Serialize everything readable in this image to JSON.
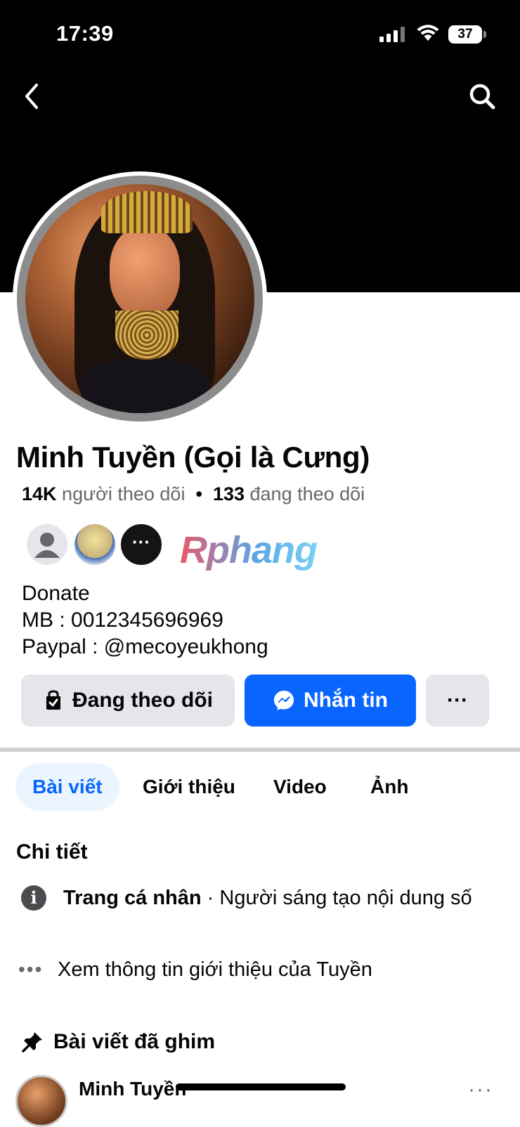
{
  "status_bar": {
    "time": "17:39",
    "battery": "37"
  },
  "profile": {
    "name": "Minh Tuyền (Gọi là Cưng)",
    "followers_count": "14K",
    "followers_label": "người theo dõi",
    "separator": "•",
    "following_count": "133",
    "following_label": "đang theo dõi",
    "friends_more": "···",
    "watermark": "Rphang",
    "bio": [
      "Donate",
      "MB : 0012345696969",
      "Paypal : @mecoyeukhong"
    ]
  },
  "actions": {
    "following_label": "Đang theo dõi",
    "message_label": "Nhắn tin",
    "more_label": "···"
  },
  "tabs": [
    {
      "label": "Bài viết",
      "active": true
    },
    {
      "label": "Giới thiệu",
      "active": false
    },
    {
      "label": "Video",
      "active": false
    },
    {
      "label": "Ảnh",
      "active": false
    }
  ],
  "details": {
    "title": "Chi tiết",
    "page_type_bold": "Trang cá nhân",
    "page_type_rest": " · Người sáng tạo nội dung số",
    "see_more": "Xem thông tin giới thiệu của Tuyền"
  },
  "pinned": {
    "title": "Bài viết đã ghim",
    "author": "Minh Tuyền",
    "more": "···"
  },
  "colors": {
    "accent": "#0866ff",
    "button_grey": "#e4e6eb",
    "muted_text": "#65676b"
  },
  "icons": [
    "back-icon",
    "search-icon",
    "info-icon",
    "pin-icon",
    "messenger-icon",
    "following-icon"
  ]
}
